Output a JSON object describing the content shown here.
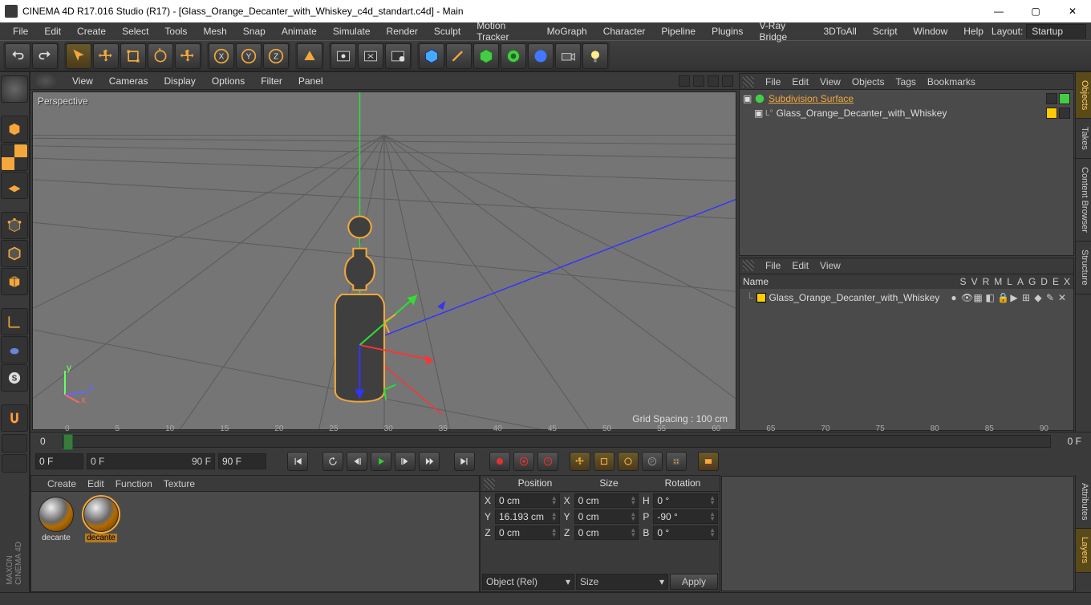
{
  "title": "CINEMA 4D R17.016 Studio (R17) - [Glass_Orange_Decanter_with_Whiskey_c4d_standart.c4d] - Main",
  "menu": [
    "File",
    "Edit",
    "Create",
    "Select",
    "Tools",
    "Mesh",
    "Snap",
    "Animate",
    "Simulate",
    "Render",
    "Sculpt",
    "Motion Tracker",
    "MoGraph",
    "Character",
    "Pipeline",
    "Plugins",
    "V-Ray Bridge",
    "3DToAll",
    "Script",
    "Window",
    "Help"
  ],
  "layout_label": "Layout:",
  "layout_value": "Startup",
  "viewport_menu": [
    "View",
    "Cameras",
    "Display",
    "Options",
    "Filter",
    "Panel"
  ],
  "viewport_label": "Perspective",
  "grid_spacing": "Grid Spacing : 100 cm",
  "objects_panel": {
    "menu": [
      "File",
      "Edit",
      "View",
      "Objects",
      "Tags",
      "Bookmarks"
    ],
    "items": [
      {
        "name": "Subdivision Surface",
        "selected": true,
        "icon": "subdiv",
        "color": "#44cc44"
      },
      {
        "name": "Glass_Orange_Decanter_with_Whiskey",
        "selected": false,
        "icon": "null",
        "color": "#ffcc00",
        "indent": 1
      }
    ]
  },
  "layers_panel": {
    "menu": [
      "File",
      "Edit",
      "View"
    ],
    "name_label": "Name",
    "cols": [
      "S",
      "V",
      "R",
      "M",
      "L",
      "A",
      "G",
      "D",
      "E",
      "X"
    ],
    "row_name": "Glass_Orange_Decanter_with_Whiskey"
  },
  "right_tabs": [
    "Objects",
    "Takes",
    "Content Browser",
    "Structure"
  ],
  "right_tabs2": [
    "Attributes",
    "Layers"
  ],
  "timeline": {
    "start": "0",
    "end": "0 F",
    "ticks": [
      "0",
      "5",
      "10",
      "15",
      "20",
      "25",
      "30",
      "35",
      "40",
      "45",
      "50",
      "55",
      "60",
      "65",
      "70",
      "75",
      "80",
      "85",
      "90"
    ]
  },
  "playbar": {
    "frame_a": "0 F",
    "slider_a": "0 F",
    "slider_b": "90 F",
    "frame_b": "90 F"
  },
  "material_menu": [
    "Create",
    "Edit",
    "Function",
    "Texture"
  ],
  "materials": [
    {
      "label": "decante",
      "selected": false
    },
    {
      "label": "decante",
      "selected": true
    }
  ],
  "coords": {
    "headers": [
      "Position",
      "Size",
      "Rotation"
    ],
    "rows": [
      {
        "axis": "X",
        "pos": "0 cm",
        "saxis": "X",
        "size": "0 cm",
        "raxis": "H",
        "rot": "0 °"
      },
      {
        "axis": "Y",
        "pos": "16.193 cm",
        "saxis": "Y",
        "size": "0 cm",
        "raxis": "P",
        "rot": "-90 °"
      },
      {
        "axis": "Z",
        "pos": "0 cm",
        "saxis": "Z",
        "size": "0 cm",
        "raxis": "B",
        "rot": "0 °"
      }
    ],
    "sel1": "Object (Rel)",
    "sel2": "Size",
    "apply": "Apply"
  }
}
